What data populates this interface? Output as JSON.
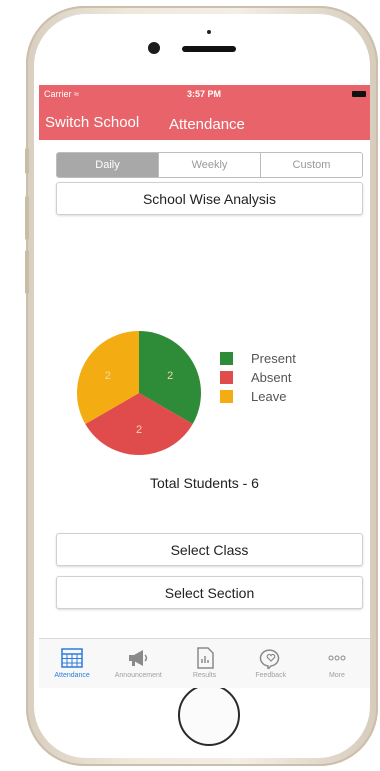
{
  "status_bar": {
    "carrier": "Carrier",
    "time": "3:57 PM"
  },
  "navbar": {
    "left_button": "Switch School",
    "title": "Attendance"
  },
  "segment": {
    "options": [
      "Daily",
      "Weekly",
      "Custom"
    ],
    "selected": "Daily"
  },
  "analysis_button": "School Wise Analysis",
  "chart_data": {
    "type": "pie",
    "slices": [
      {
        "label": "Present",
        "value": 2,
        "color": "#2e8b37"
      },
      {
        "label": "Absent",
        "value": 2,
        "color": "#e04c4c"
      },
      {
        "label": "Leave",
        "value": 2,
        "color": "#f4ac13"
      }
    ],
    "data_labels": [
      "2",
      "2",
      "2"
    ],
    "legend_position": "right"
  },
  "total_label": "Total Students - 6",
  "select_class": "Select Class",
  "select_section": "Select Section",
  "tabs": [
    {
      "label": "Attendance",
      "icon": "calendar-icon",
      "active": true
    },
    {
      "label": "Announcement",
      "icon": "megaphone-icon",
      "active": false
    },
    {
      "label": "Results",
      "icon": "document-chart-icon",
      "active": false
    },
    {
      "label": "Feedback",
      "icon": "heart-bubble-icon",
      "active": false
    },
    {
      "label": "More",
      "icon": "more-dots-icon",
      "active": false
    }
  ],
  "colors": {
    "accent": "#e8646a",
    "active_tab": "#2e7bdc"
  }
}
